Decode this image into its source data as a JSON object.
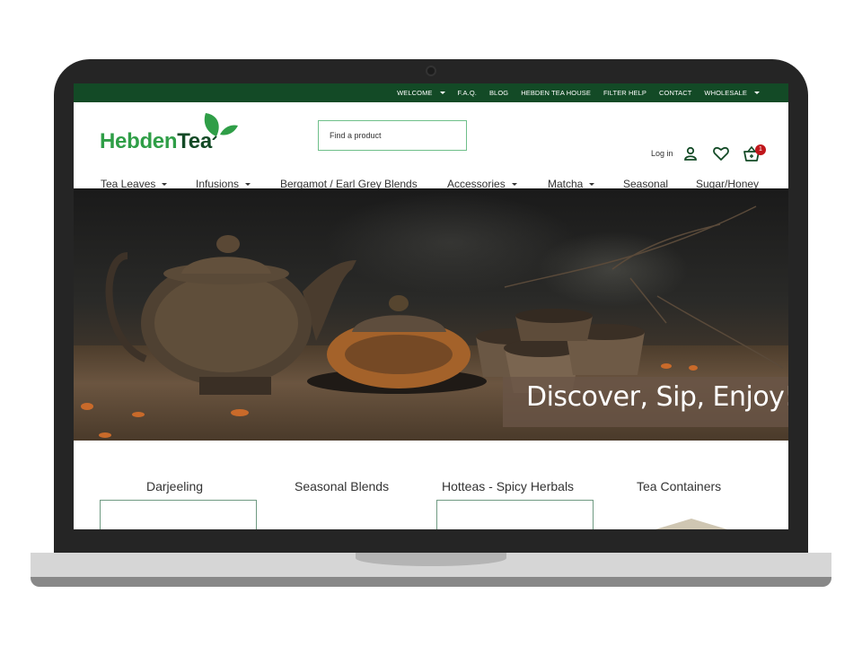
{
  "topbar": {
    "items": [
      {
        "label": "WELCOME",
        "dropdown": true
      },
      {
        "label": "F.A.Q.",
        "dropdown": false
      },
      {
        "label": "BLOG",
        "dropdown": false
      },
      {
        "label": "HEBDEN TEA HOUSE",
        "dropdown": false
      },
      {
        "label": "FILTER HELP",
        "dropdown": false
      },
      {
        "label": "CONTACT",
        "dropdown": false
      },
      {
        "label": "WHOLESALE",
        "dropdown": true
      }
    ]
  },
  "header": {
    "logo": {
      "part1": "Hebden",
      "part2": "Tea"
    },
    "search": {
      "placeholder": "Find a product",
      "value": ""
    },
    "login_label": "Log in",
    "icons": {
      "account": "user-icon",
      "wishlist": "heart-icon",
      "cart": "basket-icon"
    },
    "cart_count": "1"
  },
  "mainnav": {
    "items": [
      {
        "label": "Tea Leaves",
        "dropdown": true
      },
      {
        "label": "Infusions",
        "dropdown": true
      },
      {
        "label": "Bergamot / Earl Grey Blends",
        "dropdown": false
      },
      {
        "label": "Accessories",
        "dropdown": true
      },
      {
        "label": "Matcha",
        "dropdown": true
      },
      {
        "label": "Seasonal",
        "dropdown": false
      },
      {
        "label": "Sugar/Honey",
        "dropdown": false
      }
    ]
  },
  "hero": {
    "tagline": "Discover, Sip, Enjoy!",
    "image_alt": "teapot-and-cups-on-wooden-table"
  },
  "categories": [
    {
      "label": "Darjeeling"
    },
    {
      "label": "Seasonal Blends"
    },
    {
      "label": "Hotteas - Spicy Herbals"
    },
    {
      "label": "Tea Containers"
    }
  ],
  "colors": {
    "brand_dark_green": "#134a26",
    "brand_green": "#2f9e47",
    "badge_red": "#c0161b",
    "search_border": "#6fbf8a"
  }
}
